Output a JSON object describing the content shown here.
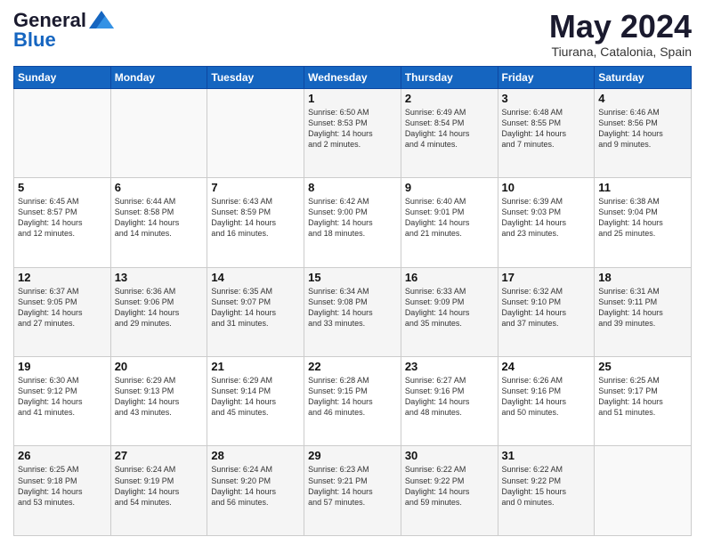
{
  "header": {
    "logo_general": "General",
    "logo_blue": "Blue",
    "month_year": "May 2024",
    "location": "Tiurana, Catalonia, Spain"
  },
  "weekdays": [
    "Sunday",
    "Monday",
    "Tuesday",
    "Wednesday",
    "Thursday",
    "Friday",
    "Saturday"
  ],
  "weeks": [
    [
      {
        "day": "",
        "info": ""
      },
      {
        "day": "",
        "info": ""
      },
      {
        "day": "",
        "info": ""
      },
      {
        "day": "1",
        "info": "Sunrise: 6:50 AM\nSunset: 8:53 PM\nDaylight: 14 hours\nand 2 minutes."
      },
      {
        "day": "2",
        "info": "Sunrise: 6:49 AM\nSunset: 8:54 PM\nDaylight: 14 hours\nand 4 minutes."
      },
      {
        "day": "3",
        "info": "Sunrise: 6:48 AM\nSunset: 8:55 PM\nDaylight: 14 hours\nand 7 minutes."
      },
      {
        "day": "4",
        "info": "Sunrise: 6:46 AM\nSunset: 8:56 PM\nDaylight: 14 hours\nand 9 minutes."
      }
    ],
    [
      {
        "day": "5",
        "info": "Sunrise: 6:45 AM\nSunset: 8:57 PM\nDaylight: 14 hours\nand 12 minutes."
      },
      {
        "day": "6",
        "info": "Sunrise: 6:44 AM\nSunset: 8:58 PM\nDaylight: 14 hours\nand 14 minutes."
      },
      {
        "day": "7",
        "info": "Sunrise: 6:43 AM\nSunset: 8:59 PM\nDaylight: 14 hours\nand 16 minutes."
      },
      {
        "day": "8",
        "info": "Sunrise: 6:42 AM\nSunset: 9:00 PM\nDaylight: 14 hours\nand 18 minutes."
      },
      {
        "day": "9",
        "info": "Sunrise: 6:40 AM\nSunset: 9:01 PM\nDaylight: 14 hours\nand 21 minutes."
      },
      {
        "day": "10",
        "info": "Sunrise: 6:39 AM\nSunset: 9:03 PM\nDaylight: 14 hours\nand 23 minutes."
      },
      {
        "day": "11",
        "info": "Sunrise: 6:38 AM\nSunset: 9:04 PM\nDaylight: 14 hours\nand 25 minutes."
      }
    ],
    [
      {
        "day": "12",
        "info": "Sunrise: 6:37 AM\nSunset: 9:05 PM\nDaylight: 14 hours\nand 27 minutes."
      },
      {
        "day": "13",
        "info": "Sunrise: 6:36 AM\nSunset: 9:06 PM\nDaylight: 14 hours\nand 29 minutes."
      },
      {
        "day": "14",
        "info": "Sunrise: 6:35 AM\nSunset: 9:07 PM\nDaylight: 14 hours\nand 31 minutes."
      },
      {
        "day": "15",
        "info": "Sunrise: 6:34 AM\nSunset: 9:08 PM\nDaylight: 14 hours\nand 33 minutes."
      },
      {
        "day": "16",
        "info": "Sunrise: 6:33 AM\nSunset: 9:09 PM\nDaylight: 14 hours\nand 35 minutes."
      },
      {
        "day": "17",
        "info": "Sunrise: 6:32 AM\nSunset: 9:10 PM\nDaylight: 14 hours\nand 37 minutes."
      },
      {
        "day": "18",
        "info": "Sunrise: 6:31 AM\nSunset: 9:11 PM\nDaylight: 14 hours\nand 39 minutes."
      }
    ],
    [
      {
        "day": "19",
        "info": "Sunrise: 6:30 AM\nSunset: 9:12 PM\nDaylight: 14 hours\nand 41 minutes."
      },
      {
        "day": "20",
        "info": "Sunrise: 6:29 AM\nSunset: 9:13 PM\nDaylight: 14 hours\nand 43 minutes."
      },
      {
        "day": "21",
        "info": "Sunrise: 6:29 AM\nSunset: 9:14 PM\nDaylight: 14 hours\nand 45 minutes."
      },
      {
        "day": "22",
        "info": "Sunrise: 6:28 AM\nSunset: 9:15 PM\nDaylight: 14 hours\nand 46 minutes."
      },
      {
        "day": "23",
        "info": "Sunrise: 6:27 AM\nSunset: 9:16 PM\nDaylight: 14 hours\nand 48 minutes."
      },
      {
        "day": "24",
        "info": "Sunrise: 6:26 AM\nSunset: 9:16 PM\nDaylight: 14 hours\nand 50 minutes."
      },
      {
        "day": "25",
        "info": "Sunrise: 6:25 AM\nSunset: 9:17 PM\nDaylight: 14 hours\nand 51 minutes."
      }
    ],
    [
      {
        "day": "26",
        "info": "Sunrise: 6:25 AM\nSunset: 9:18 PM\nDaylight: 14 hours\nand 53 minutes."
      },
      {
        "day": "27",
        "info": "Sunrise: 6:24 AM\nSunset: 9:19 PM\nDaylight: 14 hours\nand 54 minutes."
      },
      {
        "day": "28",
        "info": "Sunrise: 6:24 AM\nSunset: 9:20 PM\nDaylight: 14 hours\nand 56 minutes."
      },
      {
        "day": "29",
        "info": "Sunrise: 6:23 AM\nSunset: 9:21 PM\nDaylight: 14 hours\nand 57 minutes."
      },
      {
        "day": "30",
        "info": "Sunrise: 6:22 AM\nSunset: 9:22 PM\nDaylight: 14 hours\nand 59 minutes."
      },
      {
        "day": "31",
        "info": "Sunrise: 6:22 AM\nSunset: 9:22 PM\nDaylight: 15 hours\nand 0 minutes."
      },
      {
        "day": "",
        "info": ""
      }
    ]
  ]
}
